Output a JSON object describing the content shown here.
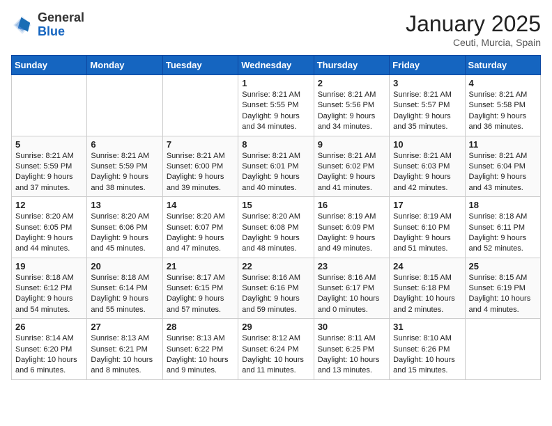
{
  "header": {
    "logo_line1": "General",
    "logo_line2": "Blue",
    "month_year": "January 2025",
    "location": "Ceuti, Murcia, Spain"
  },
  "weekdays": [
    "Sunday",
    "Monday",
    "Tuesday",
    "Wednesday",
    "Thursday",
    "Friday",
    "Saturday"
  ],
  "weeks": [
    [
      {
        "day": "",
        "sunrise": "",
        "sunset": "",
        "daylight": ""
      },
      {
        "day": "",
        "sunrise": "",
        "sunset": "",
        "daylight": ""
      },
      {
        "day": "",
        "sunrise": "",
        "sunset": "",
        "daylight": ""
      },
      {
        "day": "1",
        "sunrise": "Sunrise: 8:21 AM",
        "sunset": "Sunset: 5:55 PM",
        "daylight": "Daylight: 9 hours and 34 minutes."
      },
      {
        "day": "2",
        "sunrise": "Sunrise: 8:21 AM",
        "sunset": "Sunset: 5:56 PM",
        "daylight": "Daylight: 9 hours and 34 minutes."
      },
      {
        "day": "3",
        "sunrise": "Sunrise: 8:21 AM",
        "sunset": "Sunset: 5:57 PM",
        "daylight": "Daylight: 9 hours and 35 minutes."
      },
      {
        "day": "4",
        "sunrise": "Sunrise: 8:21 AM",
        "sunset": "Sunset: 5:58 PM",
        "daylight": "Daylight: 9 hours and 36 minutes."
      }
    ],
    [
      {
        "day": "5",
        "sunrise": "Sunrise: 8:21 AM",
        "sunset": "Sunset: 5:59 PM",
        "daylight": "Daylight: 9 hours and 37 minutes."
      },
      {
        "day": "6",
        "sunrise": "Sunrise: 8:21 AM",
        "sunset": "Sunset: 5:59 PM",
        "daylight": "Daylight: 9 hours and 38 minutes."
      },
      {
        "day": "7",
        "sunrise": "Sunrise: 8:21 AM",
        "sunset": "Sunset: 6:00 PM",
        "daylight": "Daylight: 9 hours and 39 minutes."
      },
      {
        "day": "8",
        "sunrise": "Sunrise: 8:21 AM",
        "sunset": "Sunset: 6:01 PM",
        "daylight": "Daylight: 9 hours and 40 minutes."
      },
      {
        "day": "9",
        "sunrise": "Sunrise: 8:21 AM",
        "sunset": "Sunset: 6:02 PM",
        "daylight": "Daylight: 9 hours and 41 minutes."
      },
      {
        "day": "10",
        "sunrise": "Sunrise: 8:21 AM",
        "sunset": "Sunset: 6:03 PM",
        "daylight": "Daylight: 9 hours and 42 minutes."
      },
      {
        "day": "11",
        "sunrise": "Sunrise: 8:21 AM",
        "sunset": "Sunset: 6:04 PM",
        "daylight": "Daylight: 9 hours and 43 minutes."
      }
    ],
    [
      {
        "day": "12",
        "sunrise": "Sunrise: 8:20 AM",
        "sunset": "Sunset: 6:05 PM",
        "daylight": "Daylight: 9 hours and 44 minutes."
      },
      {
        "day": "13",
        "sunrise": "Sunrise: 8:20 AM",
        "sunset": "Sunset: 6:06 PM",
        "daylight": "Daylight: 9 hours and 45 minutes."
      },
      {
        "day": "14",
        "sunrise": "Sunrise: 8:20 AM",
        "sunset": "Sunset: 6:07 PM",
        "daylight": "Daylight: 9 hours and 47 minutes."
      },
      {
        "day": "15",
        "sunrise": "Sunrise: 8:20 AM",
        "sunset": "Sunset: 6:08 PM",
        "daylight": "Daylight: 9 hours and 48 minutes."
      },
      {
        "day": "16",
        "sunrise": "Sunrise: 8:19 AM",
        "sunset": "Sunset: 6:09 PM",
        "daylight": "Daylight: 9 hours and 49 minutes."
      },
      {
        "day": "17",
        "sunrise": "Sunrise: 8:19 AM",
        "sunset": "Sunset: 6:10 PM",
        "daylight": "Daylight: 9 hours and 51 minutes."
      },
      {
        "day": "18",
        "sunrise": "Sunrise: 8:18 AM",
        "sunset": "Sunset: 6:11 PM",
        "daylight": "Daylight: 9 hours and 52 minutes."
      }
    ],
    [
      {
        "day": "19",
        "sunrise": "Sunrise: 8:18 AM",
        "sunset": "Sunset: 6:12 PM",
        "daylight": "Daylight: 9 hours and 54 minutes."
      },
      {
        "day": "20",
        "sunrise": "Sunrise: 8:18 AM",
        "sunset": "Sunset: 6:14 PM",
        "daylight": "Daylight: 9 hours and 55 minutes."
      },
      {
        "day": "21",
        "sunrise": "Sunrise: 8:17 AM",
        "sunset": "Sunset: 6:15 PM",
        "daylight": "Daylight: 9 hours and 57 minutes."
      },
      {
        "day": "22",
        "sunrise": "Sunrise: 8:16 AM",
        "sunset": "Sunset: 6:16 PM",
        "daylight": "Daylight: 9 hours and 59 minutes."
      },
      {
        "day": "23",
        "sunrise": "Sunrise: 8:16 AM",
        "sunset": "Sunset: 6:17 PM",
        "daylight": "Daylight: 10 hours and 0 minutes."
      },
      {
        "day": "24",
        "sunrise": "Sunrise: 8:15 AM",
        "sunset": "Sunset: 6:18 PM",
        "daylight": "Daylight: 10 hours and 2 minutes."
      },
      {
        "day": "25",
        "sunrise": "Sunrise: 8:15 AM",
        "sunset": "Sunset: 6:19 PM",
        "daylight": "Daylight: 10 hours and 4 minutes."
      }
    ],
    [
      {
        "day": "26",
        "sunrise": "Sunrise: 8:14 AM",
        "sunset": "Sunset: 6:20 PM",
        "daylight": "Daylight: 10 hours and 6 minutes."
      },
      {
        "day": "27",
        "sunrise": "Sunrise: 8:13 AM",
        "sunset": "Sunset: 6:21 PM",
        "daylight": "Daylight: 10 hours and 8 minutes."
      },
      {
        "day": "28",
        "sunrise": "Sunrise: 8:13 AM",
        "sunset": "Sunset: 6:22 PM",
        "daylight": "Daylight: 10 hours and 9 minutes."
      },
      {
        "day": "29",
        "sunrise": "Sunrise: 8:12 AM",
        "sunset": "Sunset: 6:24 PM",
        "daylight": "Daylight: 10 hours and 11 minutes."
      },
      {
        "day": "30",
        "sunrise": "Sunrise: 8:11 AM",
        "sunset": "Sunset: 6:25 PM",
        "daylight": "Daylight: 10 hours and 13 minutes."
      },
      {
        "day": "31",
        "sunrise": "Sunrise: 8:10 AM",
        "sunset": "Sunset: 6:26 PM",
        "daylight": "Daylight: 10 hours and 15 minutes."
      },
      {
        "day": "",
        "sunrise": "",
        "sunset": "",
        "daylight": ""
      }
    ]
  ]
}
